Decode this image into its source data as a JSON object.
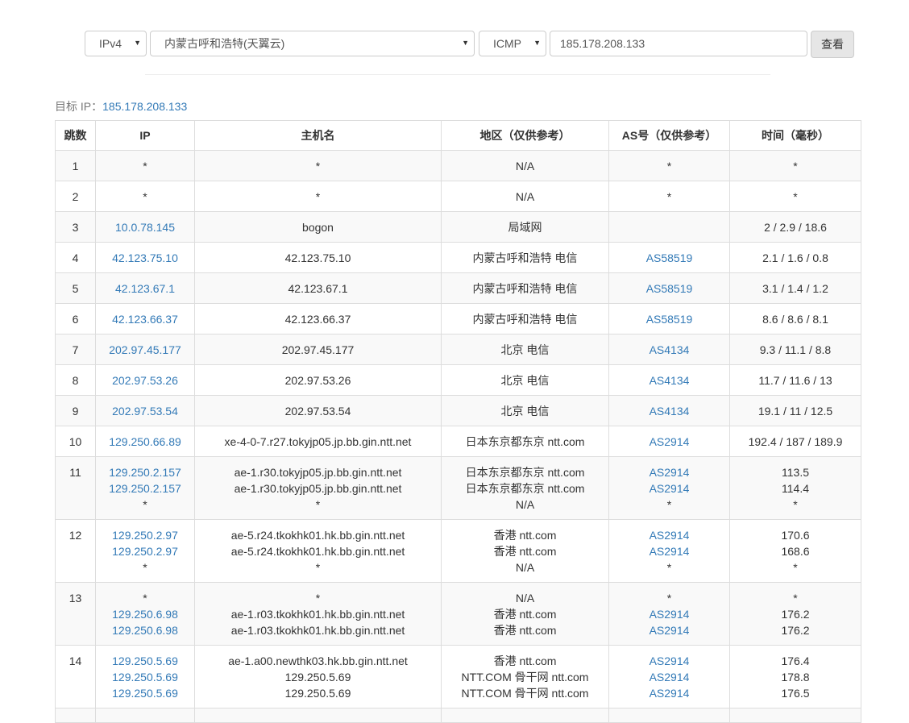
{
  "toolbar": {
    "ip_version": "IPv4",
    "location": "内蒙古呼和浩特(天翼云)",
    "protocol": "ICMP",
    "target_value": "185.178.208.133",
    "submit_label": "查看"
  },
  "target": {
    "label": "目标 IP：",
    "ip": "185.178.208.133"
  },
  "table": {
    "headers": [
      "跳数",
      "IP",
      "主机名",
      "地区（仅供参考）",
      "AS号（仅供参考）",
      "时间（毫秒）"
    ],
    "rows": [
      {
        "hop": "1",
        "ip": [
          "*"
        ],
        "host": [
          "*"
        ],
        "region": [
          "N/A"
        ],
        "as": [
          "*"
        ],
        "time": [
          "*"
        ]
      },
      {
        "hop": "2",
        "ip": [
          "*"
        ],
        "host": [
          "*"
        ],
        "region": [
          "N/A"
        ],
        "as": [
          "*"
        ],
        "time": [
          "*"
        ]
      },
      {
        "hop": "3",
        "ip": [
          "10.0.78.145"
        ],
        "host": [
          "bogon"
        ],
        "region": [
          "局域网"
        ],
        "as": [
          ""
        ],
        "time": [
          "2 / 2.9 / 18.6"
        ]
      },
      {
        "hop": "4",
        "ip": [
          "42.123.75.10"
        ],
        "host": [
          "42.123.75.10"
        ],
        "region": [
          "内蒙古呼和浩特 电信"
        ],
        "as": [
          "AS58519"
        ],
        "time": [
          "2.1 / 1.6 / 0.8"
        ]
      },
      {
        "hop": "5",
        "ip": [
          "42.123.67.1"
        ],
        "host": [
          "42.123.67.1"
        ],
        "region": [
          "内蒙古呼和浩特 电信"
        ],
        "as": [
          "AS58519"
        ],
        "time": [
          "3.1 / 1.4 / 1.2"
        ]
      },
      {
        "hop": "6",
        "ip": [
          "42.123.66.37"
        ],
        "host": [
          "42.123.66.37"
        ],
        "region": [
          "内蒙古呼和浩特 电信"
        ],
        "as": [
          "AS58519"
        ],
        "time": [
          "8.6 / 8.6 / 8.1"
        ]
      },
      {
        "hop": "7",
        "ip": [
          "202.97.45.177"
        ],
        "host": [
          "202.97.45.177"
        ],
        "region": [
          "北京 电信"
        ],
        "as": [
          "AS4134"
        ],
        "time": [
          "9.3 / 11.1 / 8.8"
        ]
      },
      {
        "hop": "8",
        "ip": [
          "202.97.53.26"
        ],
        "host": [
          "202.97.53.26"
        ],
        "region": [
          "北京 电信"
        ],
        "as": [
          "AS4134"
        ],
        "time": [
          "11.7 / 11.6 / 13"
        ]
      },
      {
        "hop": "9",
        "ip": [
          "202.97.53.54"
        ],
        "host": [
          "202.97.53.54"
        ],
        "region": [
          "北京 电信"
        ],
        "as": [
          "AS4134"
        ],
        "time": [
          "19.1 / 11 / 12.5"
        ]
      },
      {
        "hop": "10",
        "ip": [
          "129.250.66.89"
        ],
        "host": [
          "xe-4-0-7.r27.tokyjp05.jp.bb.gin.ntt.net"
        ],
        "region": [
          "日本东京都东京 ntt.com"
        ],
        "as": [
          "AS2914"
        ],
        "time": [
          "192.4 / 187 / 189.9"
        ]
      },
      {
        "hop": "11",
        "ip": [
          "129.250.2.157",
          "129.250.2.157",
          "*"
        ],
        "host": [
          "ae-1.r30.tokyjp05.jp.bb.gin.ntt.net",
          "ae-1.r30.tokyjp05.jp.bb.gin.ntt.net",
          "*"
        ],
        "region": [
          "日本东京都东京 ntt.com",
          "日本东京都东京 ntt.com",
          "N/A"
        ],
        "as": [
          "AS2914",
          "AS2914",
          "*"
        ],
        "time": [
          "113.5",
          "114.4",
          "*"
        ]
      },
      {
        "hop": "12",
        "ip": [
          "129.250.2.97",
          "129.250.2.97",
          "*"
        ],
        "host": [
          "ae-5.r24.tkokhk01.hk.bb.gin.ntt.net",
          "ae-5.r24.tkokhk01.hk.bb.gin.ntt.net",
          "*"
        ],
        "region": [
          "香港 ntt.com",
          "香港 ntt.com",
          "N/A"
        ],
        "as": [
          "AS2914",
          "AS2914",
          "*"
        ],
        "time": [
          "170.6",
          "168.6",
          "*"
        ]
      },
      {
        "hop": "13",
        "ip": [
          "*",
          "129.250.6.98",
          "129.250.6.98"
        ],
        "host": [
          "*",
          "ae-1.r03.tkokhk01.hk.bb.gin.ntt.net",
          "ae-1.r03.tkokhk01.hk.bb.gin.ntt.net"
        ],
        "region": [
          "N/A",
          "香港 ntt.com",
          "香港 ntt.com"
        ],
        "as": [
          "*",
          "AS2914",
          "AS2914"
        ],
        "time": [
          "*",
          "176.2",
          "176.2"
        ]
      },
      {
        "hop": "14",
        "ip": [
          "129.250.5.69",
          "129.250.5.69",
          "129.250.5.69"
        ],
        "host": [
          "ae-1.a00.newthk03.hk.bb.gin.ntt.net",
          "129.250.5.69",
          "129.250.5.69"
        ],
        "region": [
          "香港 ntt.com",
          "NTT.COM 骨干网 ntt.com",
          "NTT.COM 骨干网 ntt.com"
        ],
        "as": [
          "AS2914",
          "AS2914",
          "AS2914"
        ],
        "time": [
          "176.4",
          "178.8",
          "176.5"
        ]
      },
      {
        "hop": "",
        "ip": [
          ""
        ],
        "host": [
          ""
        ],
        "region": [
          ""
        ],
        "as": [
          ""
        ],
        "time": [
          ""
        ]
      }
    ]
  },
  "colors": {
    "link": "#337ab7",
    "border": "#dddddd",
    "stripe": "#f9f9f9",
    "button_bg": "#e6e6e6"
  }
}
